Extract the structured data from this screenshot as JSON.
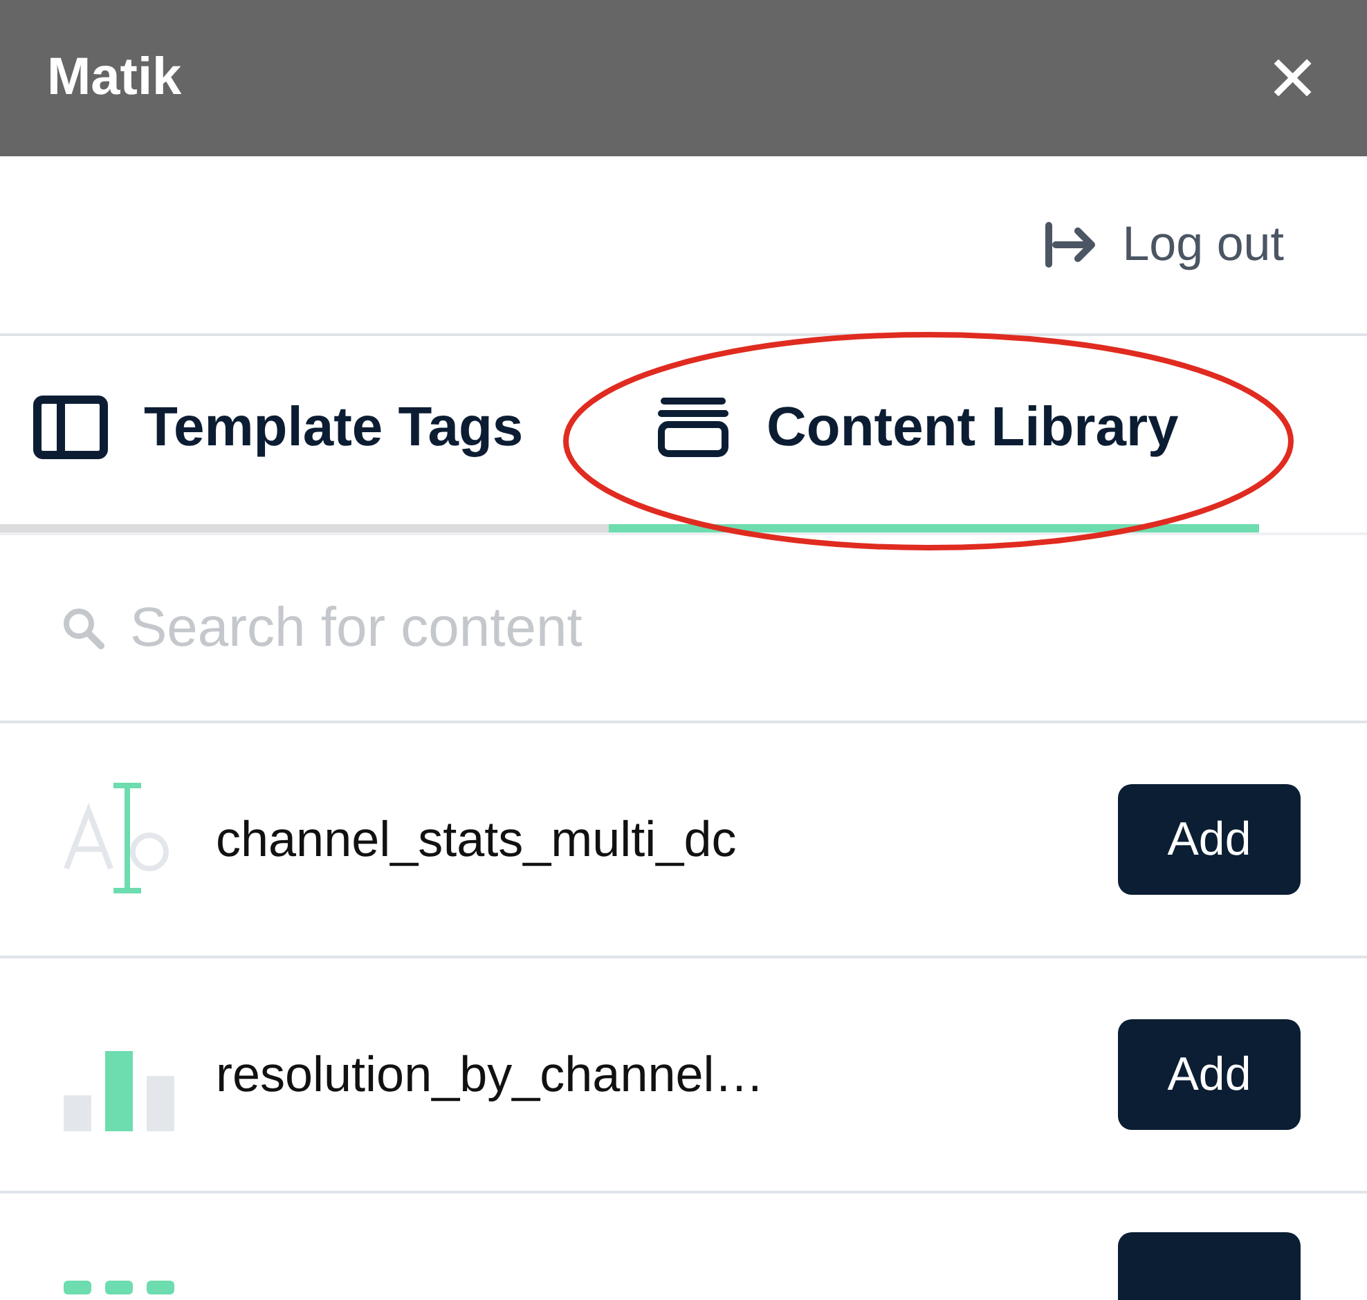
{
  "header": {
    "title": "Matik",
    "close": "✕"
  },
  "logout": {
    "label": "Log out"
  },
  "tabs": [
    {
      "label": "Template Tags",
      "selected": false
    },
    {
      "label": "Content Library",
      "selected": true
    }
  ],
  "annotation": {
    "kind": "ellipse"
  },
  "search": {
    "placeholder": "Search for content"
  },
  "items": [
    {
      "kind": "text",
      "name": "channel_stats_multi_dc",
      "button": "Add"
    },
    {
      "kind": "chart",
      "name": "resolution_by_channel…",
      "button": "Add"
    },
    {
      "kind": "table"
    }
  ]
}
